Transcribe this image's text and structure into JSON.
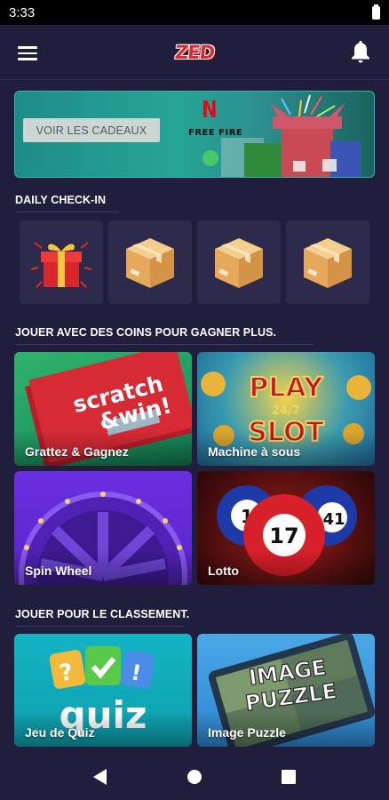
{
  "status": {
    "time": "3:33"
  },
  "app": {
    "logo": "ZED"
  },
  "banner": {
    "button_label": "VOIR LES CADEAUX",
    "netflix_logo": "N",
    "freefire_logo": "FREE FIRE"
  },
  "sections": {
    "checkin": "DAILY CHECK-IN",
    "coins": "JOUER AVEC DES COINS POUR GAGNER PLUS.",
    "ranking": "JOUER POUR LE CLASSEMENT."
  },
  "checkin_items": [
    {
      "icon": "gift-icon"
    },
    {
      "icon": "box-icon"
    },
    {
      "icon": "box-icon"
    },
    {
      "icon": "box-icon"
    }
  ],
  "coin_games": [
    {
      "label": "Grattez & Gagnez",
      "art_line1": "scratch",
      "art_line2": "&win!"
    },
    {
      "label": "Machine à sous",
      "art_line1": "PLAY",
      "art_mid": "24/7",
      "art_line2": "SLOT"
    },
    {
      "label": "Spin Wheel"
    },
    {
      "label": "Lotto",
      "ball1": "1",
      "ball2": "17",
      "ball3": "41"
    }
  ],
  "rank_games": [
    {
      "label": "Jeu de Quiz",
      "art": "quiz",
      "tile1": "?",
      "tile3": "!"
    },
    {
      "label": "Image Puzzle",
      "art_line1": "IMAGE",
      "art_line2": "PUZZLE"
    }
  ],
  "icons": {
    "menu": "menu-icon",
    "notifications": "bell-icon",
    "back": "back-triangle-icon",
    "home": "home-circle-icon",
    "recents": "recents-square-icon"
  },
  "colors": {
    "background": "#211d3d",
    "card": "#2d2a4c",
    "brand_red": "#e3262d"
  }
}
